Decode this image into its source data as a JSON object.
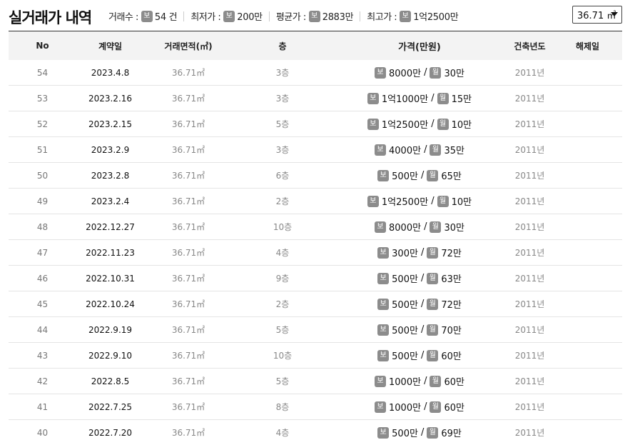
{
  "header": {
    "title": "실거래가 내역",
    "stats": [
      {
        "label": "거래수 :",
        "badge": "보",
        "value": "54 건"
      },
      {
        "label": "최저가 :",
        "badge": "보",
        "value": "200만"
      },
      {
        "label": "평균가 :",
        "badge": "보",
        "value": "2883만"
      },
      {
        "label": "최고가 :",
        "badge": "보",
        "value": "1억2500만"
      }
    ],
    "area_select": {
      "selected": "36.71 ㎡"
    }
  },
  "table": {
    "columns": [
      "No",
      "계약일",
      "거래면적(㎡)",
      "층",
      "가격(만원)",
      "건축년도",
      "해제일"
    ],
    "deposit_badge": "보",
    "monthly_badge": "월",
    "rows": [
      {
        "no": "54",
        "date": "2023.4.8",
        "area": "36.71㎡",
        "floor": "3층",
        "deposit": "8000만",
        "monthly": "30만",
        "year": "2011년",
        "cancel": ""
      },
      {
        "no": "53",
        "date": "2023.2.16",
        "area": "36.71㎡",
        "floor": "3층",
        "deposit": "1억1000만",
        "monthly": "15만",
        "year": "2011년",
        "cancel": ""
      },
      {
        "no": "52",
        "date": "2023.2.15",
        "area": "36.71㎡",
        "floor": "5층",
        "deposit": "1억2500만",
        "monthly": "10만",
        "year": "2011년",
        "cancel": ""
      },
      {
        "no": "51",
        "date": "2023.2.9",
        "area": "36.71㎡",
        "floor": "3층",
        "deposit": "4000만",
        "monthly": "35만",
        "year": "2011년",
        "cancel": ""
      },
      {
        "no": "50",
        "date": "2023.2.8",
        "area": "36.71㎡",
        "floor": "6층",
        "deposit": "500만",
        "monthly": "65만",
        "year": "2011년",
        "cancel": ""
      },
      {
        "no": "49",
        "date": "2023.2.4",
        "area": "36.71㎡",
        "floor": "2층",
        "deposit": "1억2500만",
        "monthly": "10만",
        "year": "2011년",
        "cancel": ""
      },
      {
        "no": "48",
        "date": "2022.12.27",
        "area": "36.71㎡",
        "floor": "10층",
        "deposit": "8000만",
        "monthly": "30만",
        "year": "2011년",
        "cancel": ""
      },
      {
        "no": "47",
        "date": "2022.11.23",
        "area": "36.71㎡",
        "floor": "4층",
        "deposit": "300만",
        "monthly": "72만",
        "year": "2011년",
        "cancel": ""
      },
      {
        "no": "46",
        "date": "2022.10.31",
        "area": "36.71㎡",
        "floor": "9층",
        "deposit": "500만",
        "monthly": "63만",
        "year": "2011년",
        "cancel": ""
      },
      {
        "no": "45",
        "date": "2022.10.24",
        "area": "36.71㎡",
        "floor": "2층",
        "deposit": "500만",
        "monthly": "72만",
        "year": "2011년",
        "cancel": ""
      },
      {
        "no": "44",
        "date": "2022.9.19",
        "area": "36.71㎡",
        "floor": "5층",
        "deposit": "500만",
        "monthly": "70만",
        "year": "2011년",
        "cancel": ""
      },
      {
        "no": "43",
        "date": "2022.9.10",
        "area": "36.71㎡",
        "floor": "10층",
        "deposit": "500만",
        "monthly": "60만",
        "year": "2011년",
        "cancel": ""
      },
      {
        "no": "42",
        "date": "2022.8.5",
        "area": "36.71㎡",
        "floor": "5층",
        "deposit": "1000만",
        "monthly": "60만",
        "year": "2011년",
        "cancel": ""
      },
      {
        "no": "41",
        "date": "2022.7.25",
        "area": "36.71㎡",
        "floor": "8층",
        "deposit": "1000만",
        "monthly": "60만",
        "year": "2011년",
        "cancel": ""
      },
      {
        "no": "40",
        "date": "2022.7.20",
        "area": "36.71㎡",
        "floor": "4층",
        "deposit": "500만",
        "monthly": "69만",
        "year": "2011년",
        "cancel": ""
      }
    ]
  }
}
